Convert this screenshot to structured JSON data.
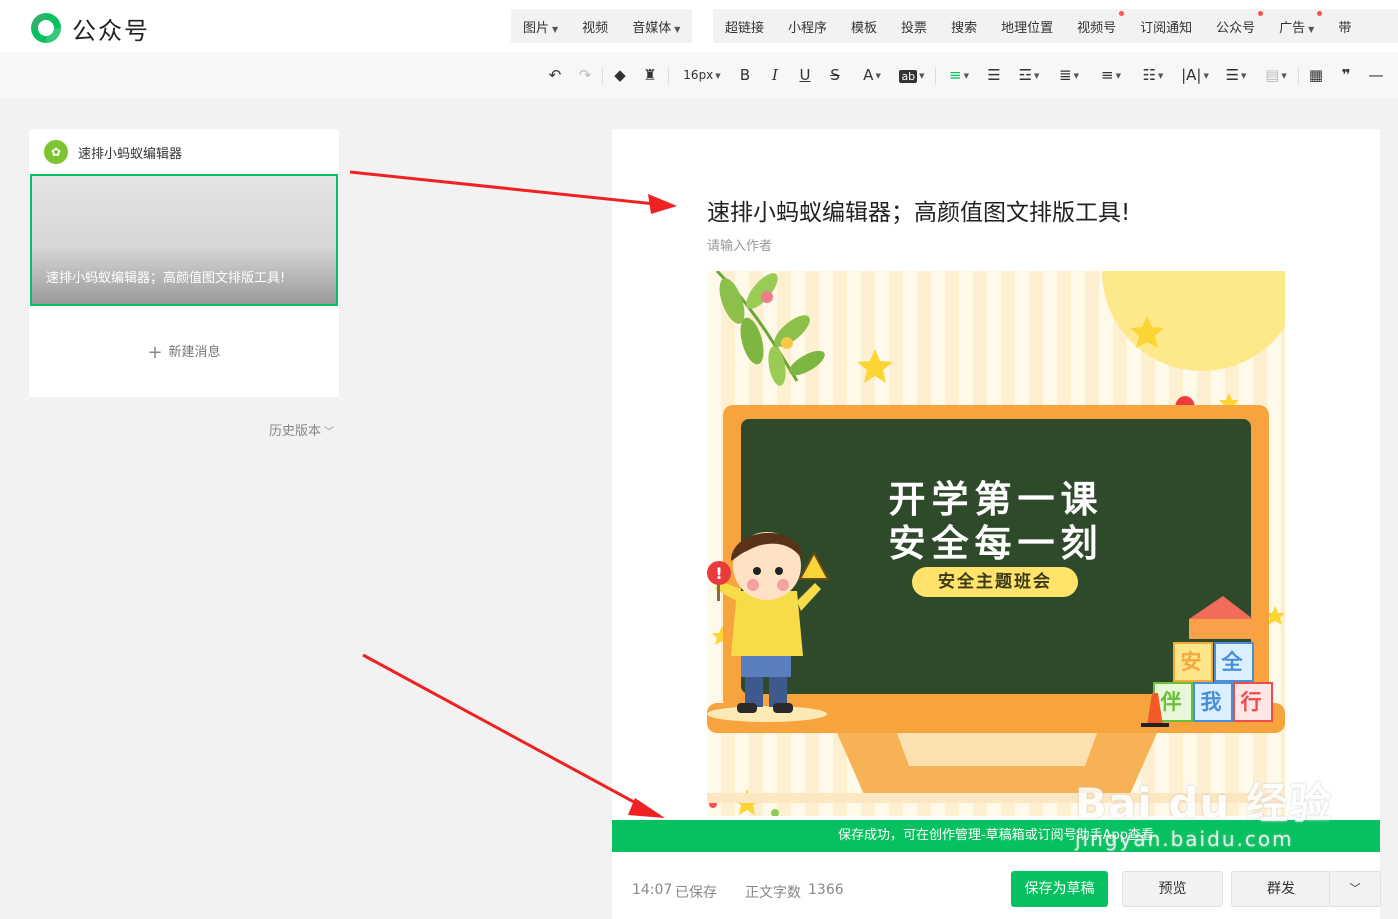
{
  "app": {
    "brand": "公众号"
  },
  "insert_menu": {
    "group1": [
      {
        "label": "图片",
        "caret": true,
        "dot": false
      },
      {
        "label": "视频",
        "caret": false,
        "dot": false
      },
      {
        "label": "音媒体",
        "caret": true,
        "dot": false
      }
    ],
    "group2": [
      {
        "label": "超链接",
        "caret": false,
        "dot": false
      },
      {
        "label": "小程序",
        "caret": false,
        "dot": false
      },
      {
        "label": "模板",
        "caret": false,
        "dot": false
      },
      {
        "label": "投票",
        "caret": false,
        "dot": false
      },
      {
        "label": "搜索",
        "caret": false,
        "dot": false
      },
      {
        "label": "地理位置",
        "caret": false,
        "dot": false
      },
      {
        "label": "视频号",
        "caret": false,
        "dot": true
      },
      {
        "label": "订阅通知",
        "caret": false,
        "dot": false
      },
      {
        "label": "公众号",
        "caret": false,
        "dot": true
      },
      {
        "label": "广告",
        "caret": true,
        "dot": true
      },
      {
        "label": "带",
        "caret": false,
        "dot": false
      }
    ]
  },
  "toolbar": {
    "font_size": "16px",
    "bold": "B",
    "italic": "I",
    "underline": "U",
    "strike": "S",
    "font_color": "A",
    "bg_color": "ab"
  },
  "sidebar": {
    "account_name": "速排小蚂蚁编辑器",
    "article_thumb_title": "速排小蚂蚁编辑器；高颜值图文排版工具!",
    "new_message": "新建消息",
    "history": "历史版本"
  },
  "editor": {
    "title": "速排小蚂蚁编辑器；高颜值图文排版工具!",
    "author_placeholder": "请输入作者",
    "cover": {
      "headline_1": "开学第一课",
      "headline_2": "安全每一刻",
      "subtitle": "安全主题班会",
      "blocks": [
        "安",
        "全",
        "伴",
        "我",
        "行"
      ]
    }
  },
  "toast": {
    "message": "保存成功，可在创作管理-草稿箱或订阅号助手App查看"
  },
  "footer": {
    "save_time": "14:07",
    "saved_text": "已保存",
    "word_count_label": "正文字数",
    "word_count": "1366",
    "save_draft": "保存为草稿",
    "preview": "预览",
    "publish": "群发",
    "more": "﹀"
  },
  "watermark": {
    "main": "Bai du 经验",
    "sub": "jingyan.baidu.com"
  },
  "colors": {
    "accent": "#07c160",
    "arrow": "#ee2222",
    "board": "#2e4a2a",
    "frame": "#f7a43f"
  }
}
